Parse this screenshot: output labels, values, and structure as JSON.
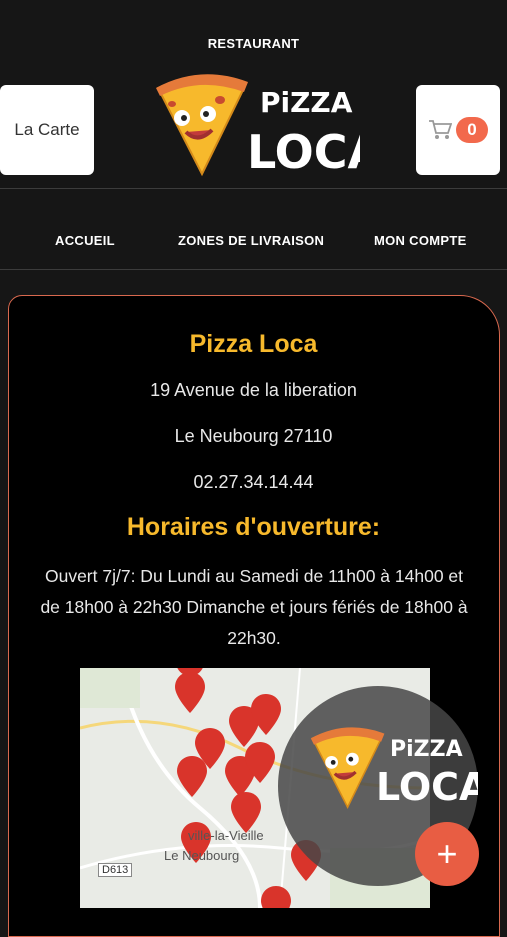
{
  "header": {
    "top_label": "RESTAURANT",
    "menu_button": "La Carte",
    "cart_count": "0",
    "logo_line1": "PiZZA",
    "logo_line2": "LOCA"
  },
  "nav": {
    "items": [
      "ACCUEIL",
      "ZONES DE LIVRAISON",
      "MON COMPTE"
    ]
  },
  "info": {
    "name": "Pizza Loca",
    "address": "19 Avenue de la liberation",
    "city": "Le Neubourg 27110",
    "phone": "02.27.34.14.44",
    "hours_title": "Horaires d'ouverture:",
    "hours_line1": "Ouvert 7j/7: Du Lundi au Samedi de 11h00 à 14h00 et",
    "hours_line2": "de 18h00 à 22h30  Dimanche et jours fériés de 18h00 à",
    "hours_line3": "22h30."
  },
  "map": {
    "town1": "Le Neubourg",
    "town2": "ville-la-Vieille",
    "road": "D613"
  },
  "fab": {
    "logo_line1": "PiZZA",
    "logo_line2": "LOCA",
    "plus": "+"
  },
  "colors": {
    "accent": "#f7b92c",
    "brand_red": "#e85d43",
    "background": "#161616"
  }
}
